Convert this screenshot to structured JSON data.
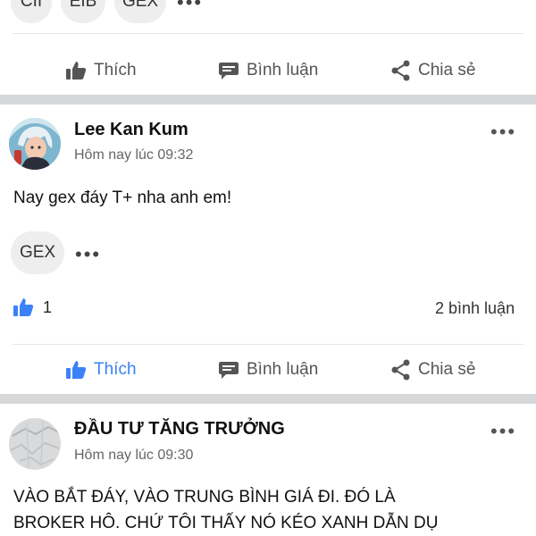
{
  "prev_post": {
    "tags": [
      "CII",
      "EIB",
      "GEX"
    ],
    "actions": {
      "like": "Thích",
      "comment": "Bình luận",
      "share": "Chia sẻ"
    }
  },
  "post1": {
    "author": "Lee Kan Kum",
    "time": "Hôm nay lúc 09:32",
    "text": "Nay gex đáy T+ nha anh em!",
    "tag": "GEX",
    "likes": "1",
    "comments": "2 bình luận",
    "actions": {
      "like": "Thích",
      "comment": "Bình luận",
      "share": "Chia sẻ"
    },
    "liked": true
  },
  "post2": {
    "author": "ĐẦU TƯ TĂNG TRƯỞNG",
    "time": "Hôm nay lúc 09:30",
    "text_lines": [
      "VÀO BẮT ĐÁY, VÀO TRUNG BÌNH GIÁ ĐI. ĐÓ LÀ",
      "BROKER HÔ. CHỨ TÔI THẤY NÓ KÉO XANH DẪN DỤ"
    ]
  },
  "colors": {
    "accent": "#3b82f6",
    "separator": "#d7d8da"
  }
}
